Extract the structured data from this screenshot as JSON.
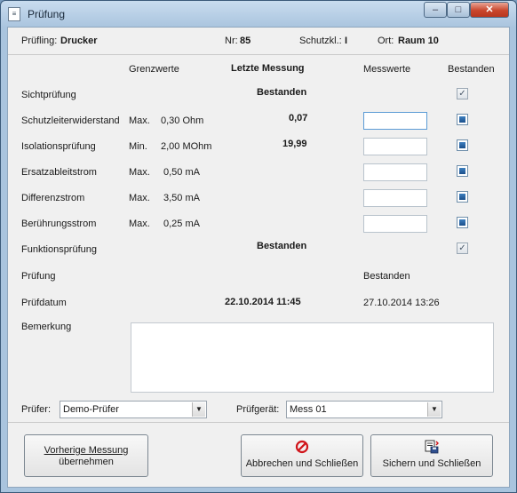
{
  "window": {
    "title": "Prüfung",
    "icon": "document-icon",
    "controls": [
      "minimize",
      "maximize",
      "close"
    ]
  },
  "header": {
    "pruefling_label": "Prüfling:",
    "pruefling_value": "Drucker",
    "nr_label": "Nr:",
    "nr_value": "85",
    "schutzkl_label": "Schutzkl.:",
    "schutzkl_value": "I",
    "ort_label": "Ort:",
    "ort_value": "Raum 10"
  },
  "columns": {
    "grenzwerte": "Grenzwerte",
    "letzte_messung": "Letzte Messung",
    "messwerte": "Messwerte",
    "bestanden": "Bestanden"
  },
  "rows": [
    {
      "label": "Sichtprüfung",
      "limit_kind": "",
      "limit_value": "",
      "last": "Bestanden",
      "input": false,
      "check": "checked"
    },
    {
      "label": "Schutzleiterwiderstand",
      "limit_kind": "Max.",
      "limit_value": "0,30 Ohm",
      "last": "0,07",
      "input": true,
      "check": "filled"
    },
    {
      "label": "Isolationsprüfung",
      "limit_kind": "Min.",
      "limit_value": "2,00 MOhm",
      "last": "19,99",
      "input": true,
      "check": "filled"
    },
    {
      "label": "Ersatzableitstrom",
      "limit_kind": "Max.",
      "limit_value": "0,50 mA",
      "last": "",
      "input": true,
      "check": "filled"
    },
    {
      "label": "Differenzstrom",
      "limit_kind": "Max.",
      "limit_value": "3,50 mA",
      "last": "",
      "input": true,
      "check": "filled"
    },
    {
      "label": "Berührungsstrom",
      "limit_kind": "Max.",
      "limit_value": "0,25 mA",
      "last": "",
      "input": true,
      "check": "filled"
    },
    {
      "label": "Funktionsprüfung",
      "limit_kind": "",
      "limit_value": "",
      "last": "Bestanden",
      "input": false,
      "check": "checked"
    }
  ],
  "summary": {
    "pruefung_label": "Prüfung",
    "pruefung_value": "Bestanden",
    "pruefdatum_label": "Prüfdatum",
    "last_date": "22.10.2014 11:45",
    "current_date": "27.10.2014 13:26",
    "bemerkung_label": "Bemerkung",
    "bemerkung_value": ""
  },
  "pruefer": {
    "label": "Prüfer:",
    "value": "Demo-Prüfer"
  },
  "pruefgeraet": {
    "label": "Prüfgerät:",
    "value": "Mess 01"
  },
  "buttons": {
    "vorherige_line1": "Vorherige Messung",
    "vorherige_line2": "übernehmen",
    "abbrechen": "Abbrechen und Schließen",
    "abbrechen_icon": "cancel-icon",
    "sichern": "Sichern und Schließen",
    "sichern_icon": "save-icon"
  },
  "colors": {
    "checkbox_fill": "#1b4f8a",
    "cancel_icon": "#d0141a",
    "close_button": "#c9462c"
  }
}
